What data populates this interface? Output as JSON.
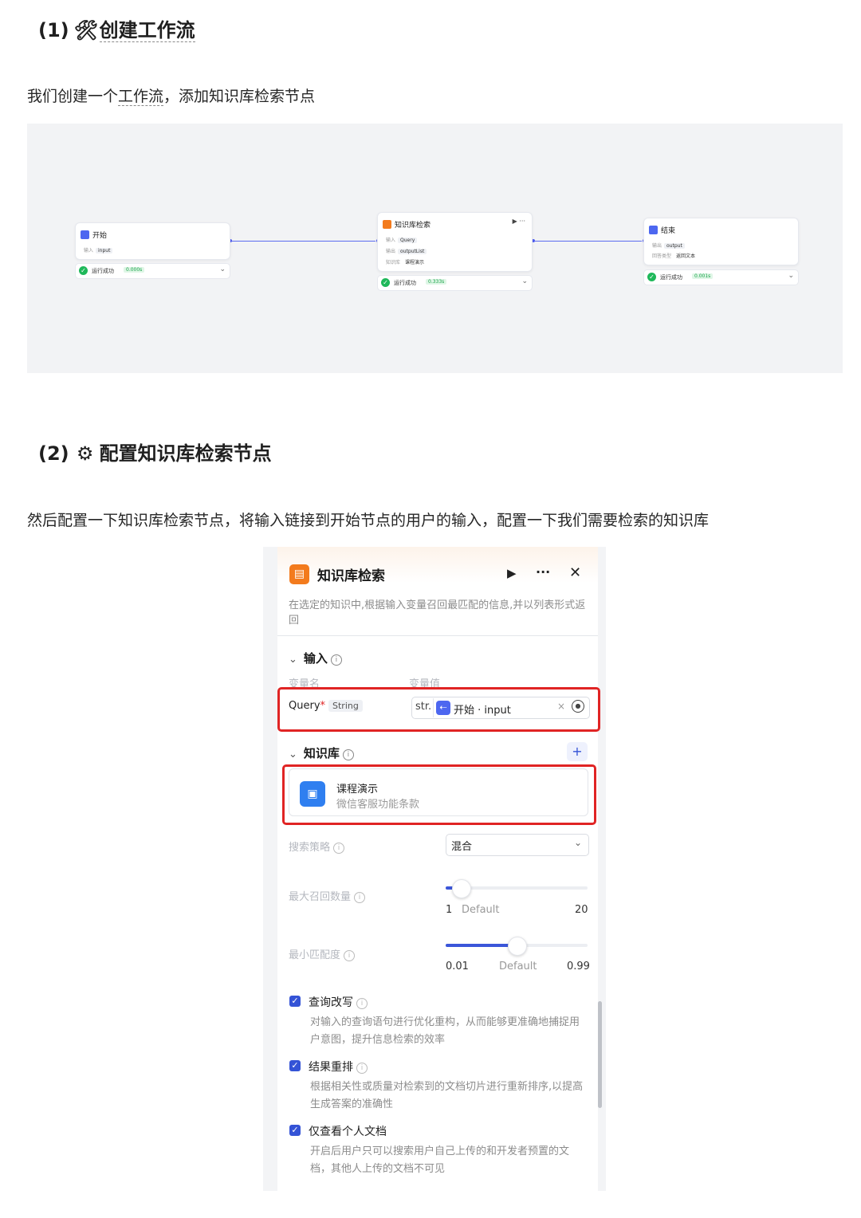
{
  "section1": {
    "number": "(1)",
    "icon": "tools-icon",
    "title": "创建工作流"
  },
  "para1": {
    "a": "我们创建一个",
    "link": "工作流",
    "b": "，添加知识库检索节点"
  },
  "workflow": {
    "start": {
      "title": "开始",
      "in_label": "输入",
      "in_value": "input",
      "status": "运行成功",
      "time": "0.000s"
    },
    "kb": {
      "title": "知识库检索",
      "in_label": "输入",
      "in_value": "Query",
      "out_label": "输出",
      "out_value": "outputList",
      "kb_label": "知识库",
      "kb_value": "课程演示",
      "status": "运行成功",
      "time": "0.333s"
    },
    "end": {
      "title": "结束",
      "out_label": "输出",
      "out_value": "output",
      "type_label": "回答类型",
      "type_value": "返回文本",
      "status": "运行成功",
      "time": "0.001s"
    }
  },
  "section2": {
    "number": "(2)",
    "icon": "gear-icon",
    "title": "配置知识库检索节点"
  },
  "para2": "然后配置一下知识库检索节点，将输入链接到开始节点的用户的输入，配置一下我们需要检索的知识库",
  "panel": {
    "title": "知识库检索",
    "description": "在选定的知识中,根据输入变量召回最匹配的信息,并以列表形式返回",
    "input_section": "输入",
    "col_name": "变量名",
    "col_value": "变量值",
    "var_name": "Query",
    "var_type": "String",
    "ref_prefix": "str.",
    "ref_node": "开始",
    "ref_var": "input",
    "kb_section": "知识库",
    "kb_name": "课程演示",
    "kb_desc": "微信客服功能条款",
    "strategy_label": "搜索策略",
    "strategy_value": "混合",
    "max_label": "最大召回数量",
    "max_min": "1",
    "max_default": "Default",
    "max_max": "20",
    "max_value": 3,
    "min_label": "最小匹配度",
    "min_min": "0.01",
    "min_default": "Default",
    "min_max": "0.99",
    "min_value": 0.5,
    "opt1_label": "查询改写",
    "opt1_desc": "对输入的查询语句进行优化重构，从而能够更准确地捕捉用户意图，提升信息检索的效率",
    "opt2_label": "结果重排",
    "opt2_desc": "根据相关性或质量对检索到的文档切片进行重新排序,以提高生成答案的准确性",
    "opt3_label": "仅查看个人文档",
    "opt3_desc": "开启后用户只可以搜索用户自己上传的和开发者预置的文档，其他人上传的文档不可见"
  },
  "colors": {
    "accent": "#3453d6",
    "highlight": "#e02424",
    "kb_orange": "#f37b1d",
    "success": "#1fb85a"
  }
}
